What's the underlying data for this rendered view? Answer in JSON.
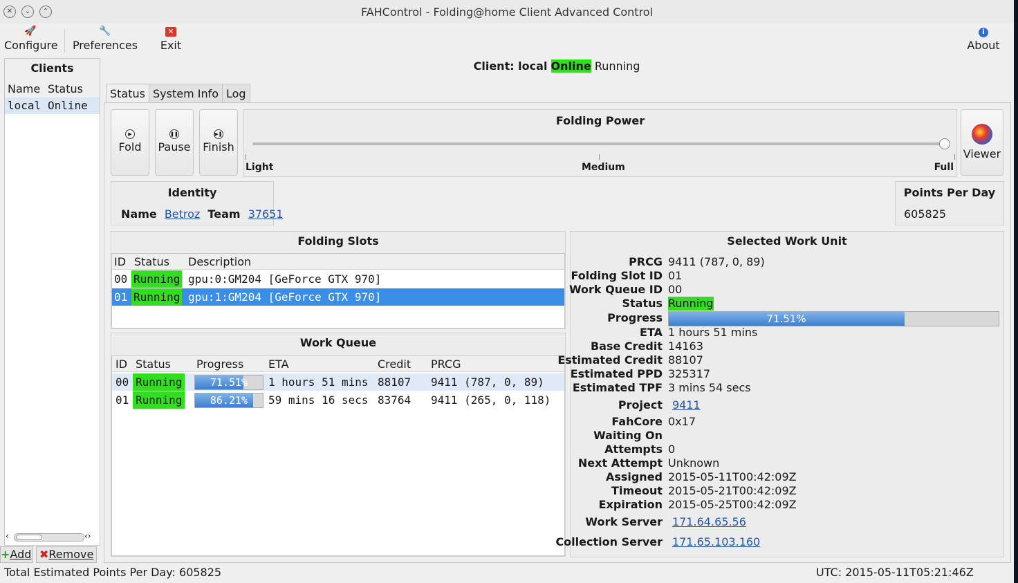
{
  "window": {
    "title": "FAHControl - Folding@home Client Advanced Control"
  },
  "toolbar": {
    "configure": "Configure",
    "preferences": "Preferences",
    "exit": "Exit",
    "about": "About"
  },
  "clients": {
    "title": "Clients",
    "col_name": "Name",
    "col_status": "Status",
    "items": [
      {
        "name": "local",
        "status": "Online"
      }
    ],
    "add": "Add",
    "remove": "Remove"
  },
  "client_header": {
    "prefix": "Client: local",
    "online": "Online",
    "state": "Running"
  },
  "tabs": [
    "Status",
    "System Info",
    "Log"
  ],
  "controls": {
    "fold": "Fold",
    "pause": "Pause",
    "finish": "Finish",
    "viewer": "Viewer"
  },
  "folding_power": {
    "title": "Folding Power",
    "light": "Light",
    "medium": "Medium",
    "full": "Full",
    "level": 1.0
  },
  "identity": {
    "title": "Identity",
    "name_label": "Name",
    "name": "Betroz",
    "team_label": "Team",
    "team": "37651"
  },
  "ppd": {
    "title": "Points Per Day",
    "value": "605825"
  },
  "slots": {
    "title": "Folding Slots",
    "headers": [
      "ID",
      "Status",
      "Description"
    ],
    "rows": [
      {
        "id": "00",
        "status": "Running",
        "desc": "gpu:0:GM204 [GeForce GTX 970]"
      },
      {
        "id": "01",
        "status": "Running",
        "desc": "gpu:1:GM204 [GeForce GTX 970]"
      }
    ]
  },
  "queue": {
    "title": "Work Queue",
    "headers": [
      "ID",
      "Status",
      "Progress",
      "ETA",
      "Credit",
      "PRCG"
    ],
    "rows": [
      {
        "id": "00",
        "status": "Running",
        "progress": "71.51%",
        "progress_value": 0.7151,
        "eta": "1 hours 51 mins",
        "credit": "88107",
        "prcg": "9411 (787, 0, 89)"
      },
      {
        "id": "01",
        "status": "Running",
        "progress": "86.21%",
        "progress_value": 0.8621,
        "eta": "59 mins 16 secs",
        "credit": "83764",
        "prcg": "9411 (265, 0, 118)"
      }
    ]
  },
  "work_unit": {
    "title": "Selected Work Unit",
    "prcg_label": "PRCG",
    "prcg": "9411 (787, 0, 89)",
    "slot_label": "Folding Slot ID",
    "slot": "01",
    "queue_label": "Work Queue ID",
    "queue": "00",
    "status_label": "Status",
    "status": "Running",
    "progress_label": "Progress",
    "progress": "71.51%",
    "progress_value": 0.7151,
    "eta_label": "ETA",
    "eta": "1 hours 51 mins",
    "base_credit_label": "Base Credit",
    "base_credit": "14163",
    "est_credit_label": "Estimated Credit",
    "est_credit": "88107",
    "est_ppd_label": "Estimated PPD",
    "est_ppd": "325317",
    "est_tpf_label": "Estimated TPF",
    "est_tpf": "3 mins 54 secs",
    "project_label": "Project",
    "project": "9411",
    "fahcore_label": "FahCore",
    "fahcore": "0x17",
    "waiting_label": "Waiting On",
    "waiting": "",
    "attempts_label": "Attempts",
    "attempts": "0",
    "next_attempt_label": "Next Attempt",
    "next_attempt": "Unknown",
    "assigned_label": "Assigned",
    "assigned": "2015-05-11T00:42:09Z",
    "timeout_label": "Timeout",
    "timeout": "2015-05-21T00:42:09Z",
    "expiration_label": "Expiration",
    "expiration": "2015-05-25T00:42:09Z",
    "work_server_label": "Work Server",
    "work_server": "171.64.65.56",
    "collection_server_label": "Collection Server",
    "collection_server": "171.65.103.160"
  },
  "statusbar": {
    "total": "Total Estimated Points Per Day: 605825",
    "utc": "UTC: 2015-05-11T05:21:46Z"
  },
  "colors": {
    "online_green": "#33dd22",
    "selection_blue": "#3a8ee6",
    "progress_blue": "#4a88d4"
  }
}
